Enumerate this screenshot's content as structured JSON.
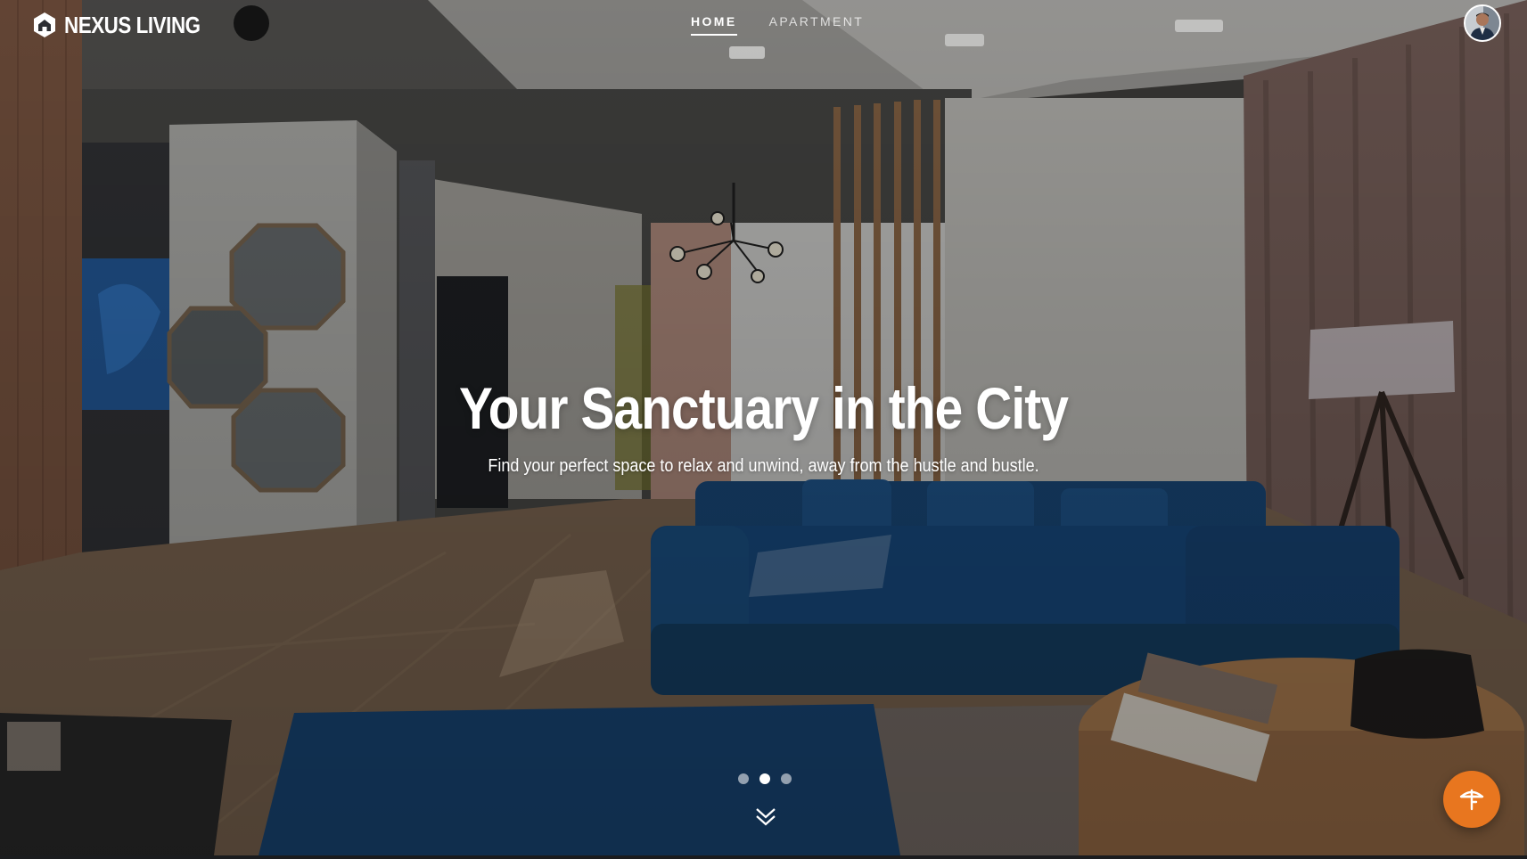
{
  "header": {
    "brand": "NEXUS LIVING",
    "logo_icon": "house-hexagon-icon",
    "nav": [
      {
        "label": "HOME",
        "active": true
      },
      {
        "label": "APARTMENT",
        "active": false
      }
    ],
    "avatar_icon": "user-avatar"
  },
  "hero": {
    "title": "Your Sanctuary in the City",
    "subtitle": "Find your perfect space to relax and unwind, away from the hustle and bustle.",
    "background": "living-room-photo",
    "slides": 3,
    "active_slide": 2,
    "scroll_icon": "chevron-double-down-icon"
  },
  "fab": {
    "icon": "beach-umbrella-icon",
    "color": "#E8761F"
  }
}
